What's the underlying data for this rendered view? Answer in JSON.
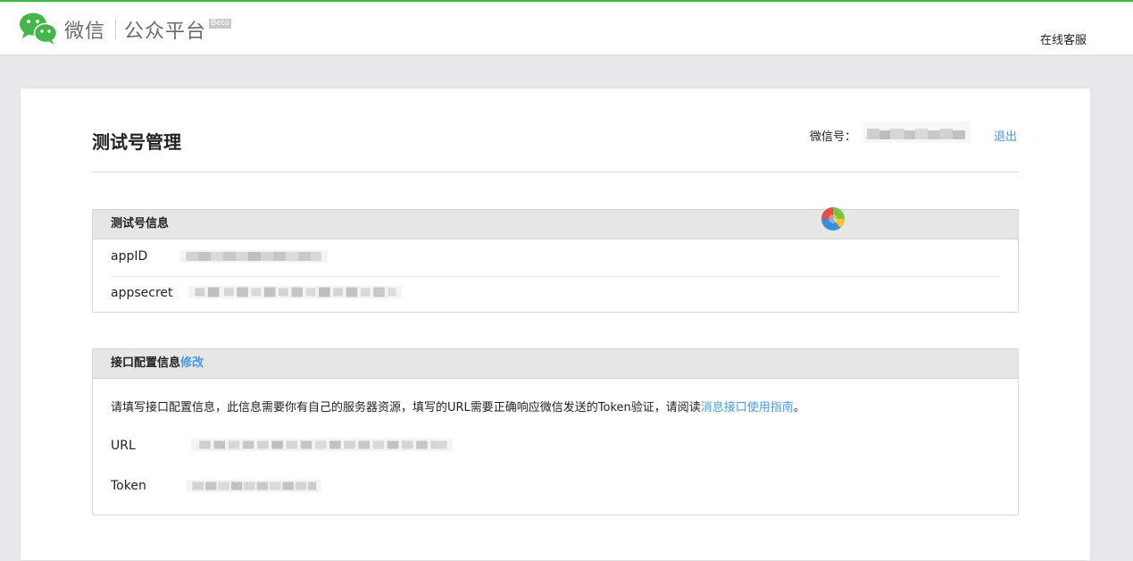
{
  "header": {
    "brand_name": "微信",
    "brand_platform": "公众平台",
    "beta_label": "Beta",
    "support_link": "在线客服"
  },
  "page": {
    "title": "测试号管理",
    "account_label": "微信号：",
    "logout_label": "退出"
  },
  "info_panel": {
    "title": "测试号信息",
    "fields": [
      {
        "label": "appID"
      },
      {
        "label": "appsecret"
      }
    ]
  },
  "config_panel": {
    "title": "接口配置信息",
    "edit_label": "修改",
    "description": "请填写接口配置信息，此信息需要你有自己的服务器资源，填写的URL需要正确响应微信发送的Token验证，请阅读",
    "guide_link": "消息接口使用指南",
    "description_end": "。",
    "fields": [
      {
        "label": "URL"
      },
      {
        "label": "Token"
      }
    ]
  },
  "colors": {
    "accent_green": "#44b549",
    "link_blue": "#459ae9",
    "panel_header": "#e6e6e6"
  },
  "icons": {
    "logo": "wechat-logo-icon",
    "badge": "colorful-circle-badge-icon"
  }
}
